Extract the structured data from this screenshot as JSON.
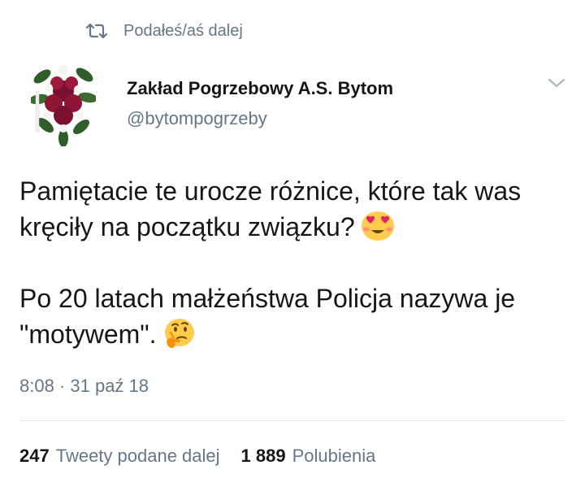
{
  "retweet_context": {
    "icon": "retweet-icon",
    "label": "Podałeś/aś dalej"
  },
  "author": {
    "avatar": "funeral-wreath-avatar",
    "name": "Zakład Pogrzebowy A.S. Bytom",
    "handle": "@bytompogrzeby"
  },
  "menu": {
    "icon": "chevron-down-icon"
  },
  "tweet": {
    "paragraph1": "Pamiętacie te urocze różnice, które tak was kręciły na początku związku?",
    "emoji1": "smiling-face-heart-eyes-emoji",
    "paragraph2": "Po 20 latach małżeństwa Policja nazywa je \"motywem\".",
    "emoji2": "thinking-face-emoji"
  },
  "timestamp": "8:08 · 31 paź 18",
  "stats": {
    "retweets_count": "247",
    "retweets_label": "Tweety podane dalej",
    "likes_count": "1 889",
    "likes_label": "Polubienia"
  },
  "colors": {
    "text": "#14171a",
    "secondary": "#657786",
    "divider": "#e1e8ed",
    "emoji_yellow": "#ffcc4d",
    "emoji_heart": "#e0245e"
  }
}
